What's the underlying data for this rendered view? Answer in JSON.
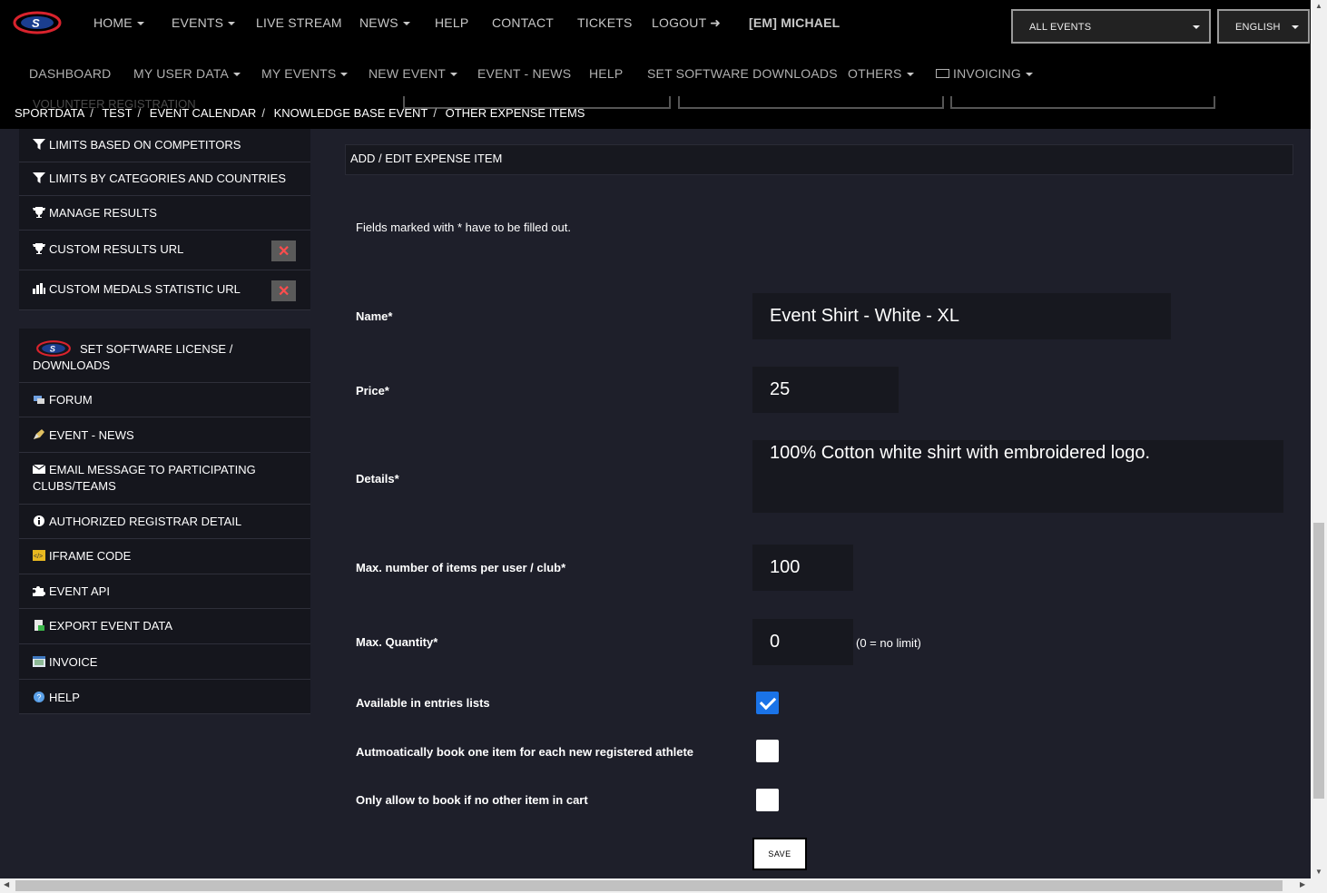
{
  "topnav": {
    "items": [
      "HOME",
      "EVENTS",
      "LIVE STREAM",
      "NEWS",
      "HELP",
      "CONTACT",
      "TICKETS",
      "LOGOUT"
    ],
    "user": "[EM] MICHAEL",
    "event_select": "ALL EVENTS",
    "language_select": "ENGLISH"
  },
  "subnav": {
    "items": [
      "DASHBOARD",
      "MY USER DATA",
      "MY EVENTS",
      "NEW EVENT",
      "EVENT - NEWS",
      "HELP",
      "SET SOFTWARE DOWNLOADS",
      "OTHERS",
      "INVOICING"
    ]
  },
  "ghost": "VOLUNTEER REGISTRATION",
  "breadcrumb": [
    "SPORTDATA",
    "TEST",
    "EVENT CALENDAR",
    "KNOWLEDGE BASE EVENT",
    "OTHER EXPENSE ITEMS"
  ],
  "sidebar": {
    "items": [
      {
        "label": "LIMITS BASED ON COMPETITORS",
        "icon": "filter-icon"
      },
      {
        "label": "LIMITS BY CATEGORIES AND COUNTRIES",
        "icon": "filter-icon"
      },
      {
        "label": "MANAGE RESULTS",
        "icon": "trophy-icon"
      },
      {
        "label": "CUSTOM RESULTS URL",
        "icon": "trophy-icon"
      },
      {
        "label": "CUSTOM MEDALS STATISTIC URL",
        "icon": "bar-chart-icon"
      },
      {
        "label": "SET SOFTWARE LICENSE / DOWNLOADS",
        "icon": "sportdata-logo"
      },
      {
        "label": "FORUM",
        "icon": "forum-icon"
      },
      {
        "label": "EVENT - NEWS",
        "icon": "news-icon"
      },
      {
        "label": "EMAIL MESSAGE TO PARTICIPATING CLUBS/TEAMS",
        "icon": "envelope-icon"
      },
      {
        "label": "AUTHORIZED REGISTRAR DETAIL",
        "icon": "info-icon"
      },
      {
        "label": "IFRAME CODE",
        "icon": "code-icon"
      },
      {
        "label": "EVENT API",
        "icon": "puzzle-icon"
      },
      {
        "label": "EXPORT EVENT DATA",
        "icon": "export-icon"
      },
      {
        "label": "INVOICE",
        "icon": "invoice-icon"
      },
      {
        "label": "HELP",
        "icon": "help-icon"
      }
    ]
  },
  "form": {
    "title": "ADD / EDIT EXPENSE ITEM",
    "note": "Fields marked with * have to be filled out.",
    "name_label": "Name*",
    "name_value": "Event Shirt - White - XL",
    "price_label": "Price*",
    "price_value": "25",
    "details_label": "Details*",
    "details_value": "100% Cotton white shirt with embroidered logo.",
    "max_items_label": "Max. number of items per user / club*",
    "max_items_value": "100",
    "max_qty_label": "Max. Quantity*",
    "max_qty_value": "0",
    "max_qty_hint": "(0 = no limit)",
    "available_label": "Available in entries lists",
    "available_checked": true,
    "auto_book_label": "Autmoatically book one item for each new registered athlete",
    "auto_book_checked": false,
    "only_allow_label": "Only allow to book if no other item in cart",
    "only_allow_checked": false,
    "save_label": "SAVE"
  },
  "colors": {
    "accent": "#1a73e8",
    "delete": "#ff4d4d",
    "logo_red": "#d9232d"
  }
}
